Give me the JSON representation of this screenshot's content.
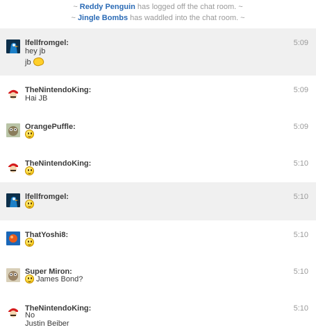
{
  "notices": [
    {
      "prefix": "~ ",
      "user": "Reddy Penguin",
      "text": " has logged off the chat room. ~"
    },
    {
      "prefix": "~ ",
      "user": "Jingle Bombs",
      "text": " has waddled into the chat room. ~"
    }
  ],
  "messages": [
    {
      "user": "lfellfromgel:",
      "time": "5:09",
      "lines": [
        "hey jb",
        "jb"
      ],
      "avatar": "blue-penguin-avatar",
      "shaded": true
    },
    {
      "user": "TheNintendoKing:",
      "time": "5:09",
      "lines": [
        "Hai JB"
      ],
      "avatar": "mario-avatar",
      "shaded": false
    },
    {
      "user": "OrangePuffle:",
      "time": "5:09",
      "lines": [
        ""
      ],
      "avatar": "creature-avatar",
      "shaded": false
    },
    {
      "user": "TheNintendoKing:",
      "time": "5:10",
      "lines": [
        ""
      ],
      "avatar": "mario-avatar",
      "shaded": false
    },
    {
      "user": "lfellfromgel:",
      "time": "5:10",
      "lines": [
        ""
      ],
      "avatar": "blue-penguin-avatar",
      "shaded": true
    },
    {
      "user": "ThatYoshi8:",
      "time": "5:10",
      "lines": [
        ""
      ],
      "avatar": "yoshi-avatar",
      "shaded": false
    },
    {
      "user": "Super Miron:",
      "time": "5:10",
      "lines": [
        "James Bond?"
      ],
      "avatar": "creature-avatar",
      "shaded": false
    },
    {
      "user": "TheNintendoKing:",
      "time": "5:10",
      "lines": [
        "No",
        "Justin Beiber"
      ],
      "avatar": "mario-avatar",
      "shaded": false
    }
  ],
  "colors": {
    "username_link": "#2a6ab5",
    "muted": "#9a9a9a",
    "shaded_row": "#f0f0f0"
  }
}
